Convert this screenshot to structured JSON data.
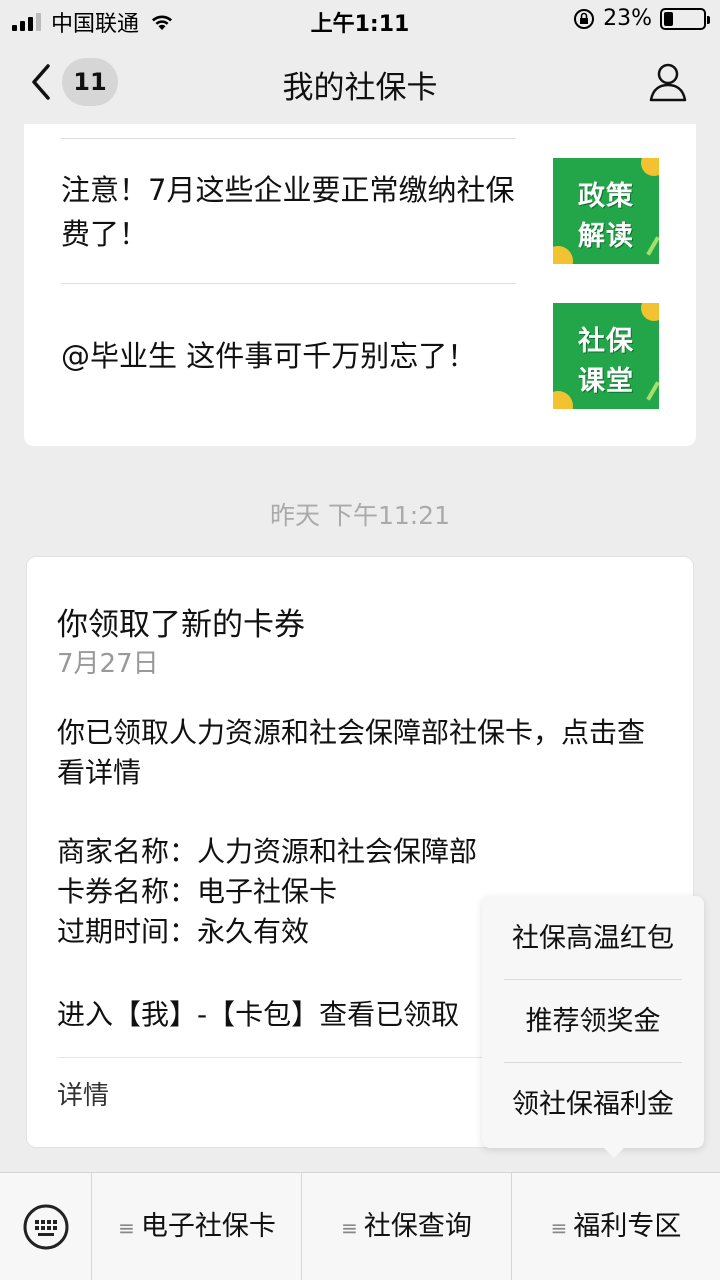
{
  "status_bar": {
    "carrier": "中国联通",
    "time": "上午1:11",
    "battery_percent": "23%",
    "battery_level": 0.23
  },
  "nav": {
    "badge_count": "11",
    "title": "我的社保卡",
    "back_icon": "chevron-left-icon",
    "profile_icon": "person-icon"
  },
  "articles": [
    {
      "title": "注意！7月这些企业要正常缴纳社保费了！",
      "thumb_lines": [
        "政策",
        "解读"
      ]
    },
    {
      "title": "@毕业生 这件事可千万别忘了！",
      "thumb_lines": [
        "社保",
        "课堂"
      ]
    }
  ],
  "timestamp": "昨天 下午11:21",
  "notice": {
    "title": "你领取了新的卡券",
    "date": "7月27日",
    "description": "你已领取人力资源和社会保障部社保卡，点击查看详情",
    "merchant_label": "商家名称：",
    "merchant_value": "人力资源和社会保障部",
    "card_label": "卡券名称：",
    "card_value": "电子社保卡",
    "expire_label": "过期时间：",
    "expire_value": "永久有效",
    "enter_text": "进入【我】-【卡包】查看已领取",
    "detail_link": "详情"
  },
  "popup_menu": [
    "社保高温红包",
    "推荐领奖金",
    "领社保福利金"
  ],
  "bottom_tabs": [
    "电子社保卡",
    "社保查询",
    "福利专区"
  ],
  "colors": {
    "thumb_green": "#23a64a",
    "background": "#ededed"
  }
}
